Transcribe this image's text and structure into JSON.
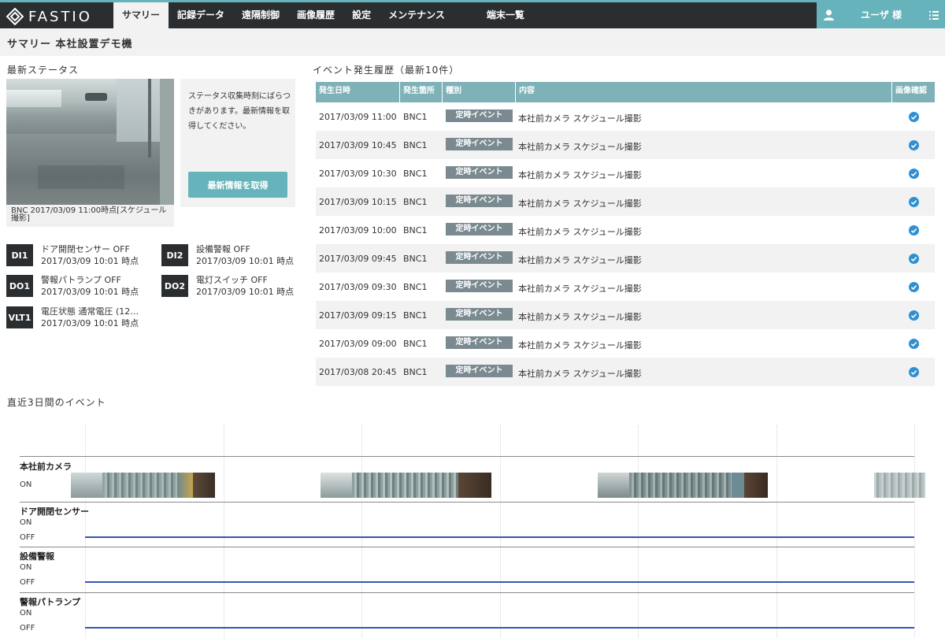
{
  "app": {
    "logo_text": "FASTIO"
  },
  "nav": {
    "items": [
      {
        "label": "サマリー",
        "active": true
      },
      {
        "label": "記録データ"
      },
      {
        "label": "遠隔制御"
      },
      {
        "label": "画像履歴"
      },
      {
        "label": "設定"
      },
      {
        "label": "メンテナンス"
      }
    ],
    "terminals": "端末一覧",
    "user_name": "ユーザ 様"
  },
  "page": {
    "title": "サマリー 本社設置デモ機"
  },
  "status": {
    "section_title": "最新ステータス",
    "camera_caption": "BNC 2017/03/09 11:00時点[スケジュール撮影]",
    "info_text": "ステータス収集時刻にばらつきがあります。最新情報を取得してください。",
    "refresh_label": "最新情報を取得",
    "io": [
      {
        "badge": "DI1",
        "line1": "ドア開閉センサー OFF",
        "line2": "2017/03/09 10:01 時点"
      },
      {
        "badge": "DI2",
        "line1": "設備警報 OFF",
        "line2": "2017/03/09 10:01 時点"
      },
      {
        "badge": "DO1",
        "line1": "警報パトランプ OFF",
        "line2": "2017/03/09 10:01 時点"
      },
      {
        "badge": "DO2",
        "line1": "電灯スイッチ OFF",
        "line2": "2017/03/09 10:01 時点"
      },
      {
        "badge": "VLT1",
        "line1": "電圧状態 通常電圧 (12…",
        "line2": "2017/03/09 10:01 時点"
      }
    ]
  },
  "events": {
    "section_title": "イベント発生履歴（最新10件）",
    "headers": [
      "発生日時",
      "発生箇所",
      "種別",
      "内容",
      "画像確認"
    ],
    "rows": [
      {
        "time": "2017/03/09 11:00",
        "source": "BNC1",
        "type": "定時イベント",
        "content": "本社前カメラ スケジュール撮影"
      },
      {
        "time": "2017/03/09 10:45",
        "source": "BNC1",
        "type": "定時イベント",
        "content": "本社前カメラ スケジュール撮影"
      },
      {
        "time": "2017/03/09 10:30",
        "source": "BNC1",
        "type": "定時イベント",
        "content": "本社前カメラ スケジュール撮影"
      },
      {
        "time": "2017/03/09 10:15",
        "source": "BNC1",
        "type": "定時イベント",
        "content": "本社前カメラ スケジュール撮影"
      },
      {
        "time": "2017/03/09 10:00",
        "source": "BNC1",
        "type": "定時イベント",
        "content": "本社前カメラ スケジュール撮影"
      },
      {
        "time": "2017/03/09 09:45",
        "source": "BNC1",
        "type": "定時イベント",
        "content": "本社前カメラ スケジュール撮影"
      },
      {
        "time": "2017/03/09 09:30",
        "source": "BNC1",
        "type": "定時イベント",
        "content": "本社前カメラ スケジュール撮影"
      },
      {
        "time": "2017/03/09 09:15",
        "source": "BNC1",
        "type": "定時イベント",
        "content": "本社前カメラ スケジュール撮影"
      },
      {
        "time": "2017/03/09 09:00",
        "source": "BNC1",
        "type": "定時イベント",
        "content": "本社前カメラ スケジュール撮影"
      },
      {
        "time": "2017/03/08 20:45",
        "source": "BNC1",
        "type": "定時イベント",
        "content": "本社前カメラ スケジュール撮影"
      }
    ]
  },
  "timeline": {
    "section_title": "直近3日間のイベント",
    "tracks": [
      {
        "label": "本社前カメラ",
        "states": [
          "ON"
        ]
      },
      {
        "label": "ドア開閉センサー",
        "states": [
          "ON",
          "OFF"
        ]
      },
      {
        "label": "設備警報",
        "states": [
          "ON",
          "OFF"
        ]
      },
      {
        "label": "警報パトランプ",
        "states": [
          "ON",
          "OFF"
        ]
      }
    ]
  },
  "colors": {
    "accent": "#67b3bb",
    "header_bg": "#2b2e30",
    "table_header": "#7fb2b8",
    "badge": "#7a8a90",
    "check": "#2f8fd1",
    "timeline_line": "#3456b0"
  }
}
